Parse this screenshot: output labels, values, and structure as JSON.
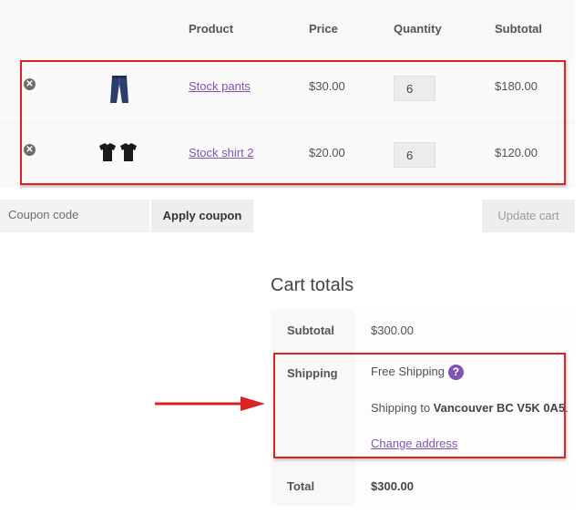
{
  "table": {
    "headers": {
      "product": "Product",
      "price": "Price",
      "quantity": "Quantity",
      "subtotal": "Subtotal"
    },
    "rows": [
      {
        "name": "Stock pants",
        "price": "$30.00",
        "quantity": "6",
        "subtotal": "$180.00",
        "image_icon": "jeans-icon"
      },
      {
        "name": "Stock shirt 2",
        "price": "$20.00",
        "quantity": "6",
        "subtotal": "$120.00",
        "image_icon": "tshirts-icon"
      }
    ]
  },
  "coupon": {
    "placeholder": "Coupon code",
    "apply_label": "Apply coupon",
    "update_label": "Update cart"
  },
  "totals": {
    "title": "Cart totals",
    "subtotal_label": "Subtotal",
    "subtotal_value": "$300.00",
    "shipping_label": "Shipping",
    "shipping_method": "Free Shipping",
    "shipping_to_prefix": "Shipping to ",
    "shipping_to_address": "Vancouver BC V5K 0A5",
    "shipping_to_suffix": ".",
    "change_address": "Change address",
    "total_label": "Total",
    "total_value": "$300.00"
  },
  "colors": {
    "highlight": "#dd2222",
    "link": "#7f54b3",
    "arrow": "#dd2222"
  }
}
